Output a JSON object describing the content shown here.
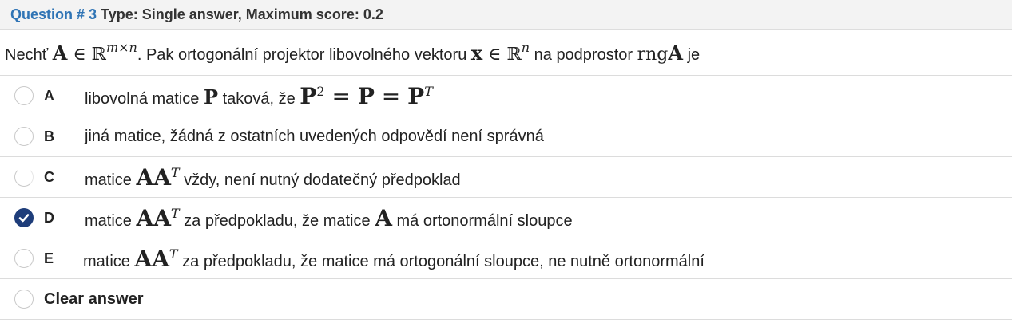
{
  "header": {
    "question_label": "Question # 3",
    "question_meta": "Type: Single answer, Maximum score: 0.2"
  },
  "stem": {
    "t1": "Nechť ",
    "m_A": "A",
    "m_in": " ∈ ",
    "m_R": "ℝ",
    "m_dims": "m×n",
    "t2": ". Pak ortogonální projektor libovolného vektoru ",
    "m_x": "x",
    "m_in2": " ∈ ",
    "m_R2": "ℝ",
    "m_n": "n",
    "t3": " na podprostor ",
    "m_rng": "rng",
    "m_A2": "A",
    "t4": " je"
  },
  "options": [
    {
      "letter": "A",
      "selected": false,
      "t1": "libovolná matice ",
      "m_P": "P",
      "t2": " taková, že ",
      "m_P2": "P",
      "sup2": "2",
      "m_eq1": " = ",
      "m_P3": "P",
      "m_eq2": " = ",
      "m_P4": "P",
      "supT": "T"
    },
    {
      "letter": "B",
      "selected": false,
      "t1": "jiná matice, žádná z ostatních uvedených odpovědí není správná"
    },
    {
      "letter": "C",
      "selected": false,
      "t1": "matice ",
      "m_AA": "AA",
      "supT": "T",
      "t2": " vždy, není nutný dodatečný předpoklad"
    },
    {
      "letter": "D",
      "selected": true,
      "t1": "matice ",
      "m_AA": "AA",
      "supT": "T",
      "t2": " za předpokladu, že matice ",
      "m_A": "A",
      "t3": " má ortonormální sloupce"
    },
    {
      "letter": "E",
      "selected": false,
      "t1": "matice ",
      "m_AA": "AA",
      "supT": "T",
      "t2": " za předpokladu, že matice má ortogonální sloupce, ne nutně ortonormální"
    }
  ],
  "clear_answer": "Clear answer",
  "colors": {
    "accent": "#2f74b5",
    "checked": "#1e3d7a",
    "border": "#dcdcdc",
    "header_bg": "#f3f3f3"
  }
}
